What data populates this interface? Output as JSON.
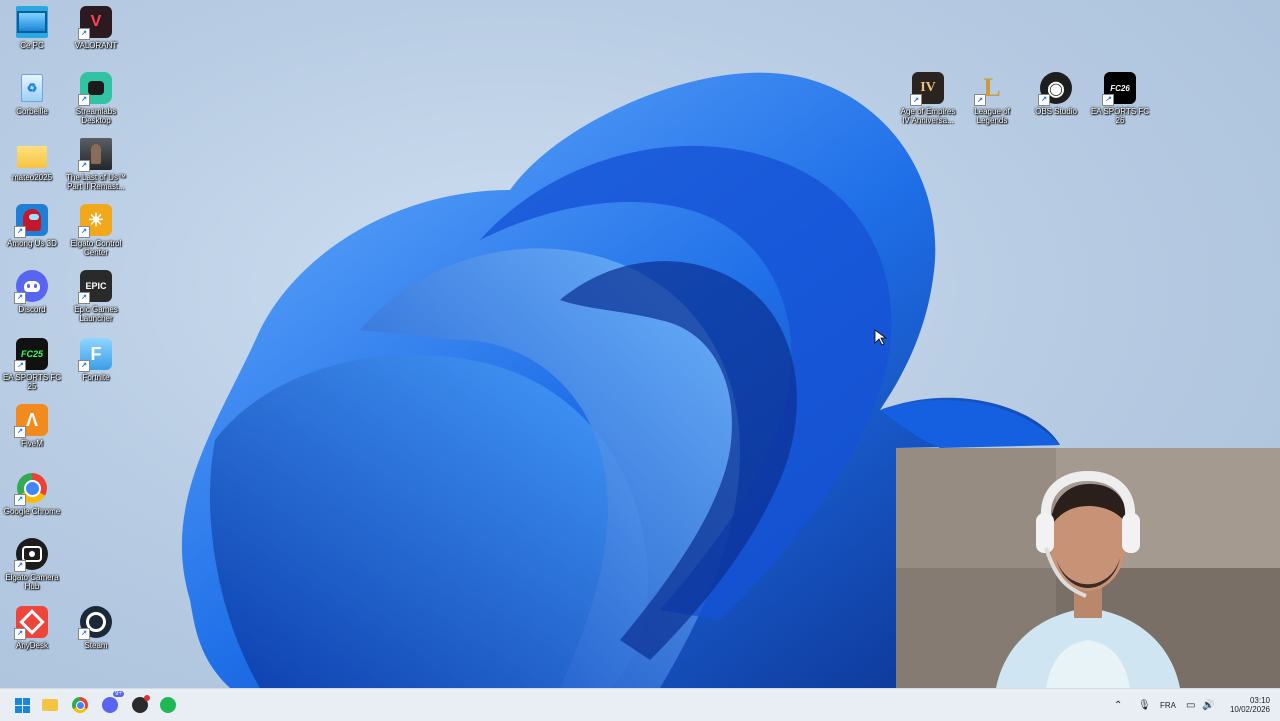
{
  "desktop": {
    "left_column_a": [
      {
        "label": "Ce PC",
        "icon": "monitor-icon",
        "color": "#2aa8e0"
      },
      {
        "label": "Corbeille",
        "icon": "recycle-bin-icon",
        "color": "#5fb0e8"
      },
      {
        "label": "mateo2025",
        "icon": "folder-icon",
        "color": "#f4c542"
      },
      {
        "label": "Among Us 3D",
        "icon": "among-us-icon",
        "color": "#c2192d"
      },
      {
        "label": "Discord",
        "icon": "discord-icon",
        "color": "#5865f2"
      },
      {
        "label": "EA SPORTS FC 25",
        "icon": "fc25-icon",
        "color": "#111111"
      },
      {
        "label": "FiveM",
        "icon": "fivem-icon",
        "color": "#f28b1e"
      },
      {
        "label": "Google Chrome",
        "icon": "chrome-icon",
        "color": "#ffffff"
      },
      {
        "label": "Elgato Camera Hub",
        "icon": "elgato-camera-icon",
        "color": "#1c1c1c"
      },
      {
        "label": "AnyDesk",
        "icon": "anydesk-icon",
        "color": "#ef443b"
      }
    ],
    "left_column_b": [
      {
        "label": "VALORANT",
        "icon": "valorant-icon",
        "color": "#2b1a1f"
      },
      {
        "label": "Streamlabs Desktop",
        "icon": "streamlabs-icon",
        "color": "#31c3a2"
      },
      {
        "label": "The Last of Us™ Part II Remast...",
        "icon": "tlou-icon",
        "color": "#3b3f44"
      },
      {
        "label": "Elgato Control Center",
        "icon": "elgato-control-icon",
        "color": "#f2a81d"
      },
      {
        "label": "Epic Games Launcher",
        "icon": "epic-games-icon",
        "color": "#2a2a2a"
      },
      {
        "label": "Fortnite",
        "icon": "fortnite-icon",
        "color": "#5ab9f0"
      },
      {
        "label": "Steam",
        "icon": "steam-icon",
        "color": "#1b2838"
      }
    ],
    "right_row": [
      {
        "label": "Age of Empires IV Anniversa...",
        "icon": "aoe4-icon",
        "color": "#2a2320",
        "glyph": "IV"
      },
      {
        "label": "League of Legends",
        "icon": "lol-icon",
        "color": "#0a1428",
        "glyph": "L"
      },
      {
        "label": "OBS Studio",
        "icon": "obs-icon",
        "color": "#1e1e1e",
        "glyph": "◉"
      },
      {
        "label": "EA SPORTS FC 26",
        "icon": "fc26-icon",
        "color": "#000000",
        "glyph": "FC26"
      }
    ],
    "glyphs": {
      "epic": "EPIC",
      "fc25": "FC25",
      "fortnite": "F",
      "valorant": "V"
    }
  },
  "taskbar": {
    "apps": [
      {
        "name": "start-button",
        "icon": "windows-icon",
        "color": "#1a86d9"
      },
      {
        "name": "file-explorer-button",
        "icon": "folder-icon",
        "color": "#f4c542"
      },
      {
        "name": "chrome-taskbar-button",
        "icon": "chrome-icon",
        "color": "#e94235"
      },
      {
        "name": "discord-taskbar-button",
        "icon": "discord-icon",
        "color": "#5865f2",
        "badge": "9+"
      },
      {
        "name": "obs-taskbar-button",
        "icon": "obs-icon",
        "color": "#2b2b2b"
      },
      {
        "name": "spotify-taskbar-button",
        "icon": "spotify-icon",
        "color": "#1db954"
      }
    ],
    "language": "FRA",
    "time": "03:10",
    "date": "10/02/2026"
  },
  "colors": {
    "accent": "#1a86d9"
  }
}
